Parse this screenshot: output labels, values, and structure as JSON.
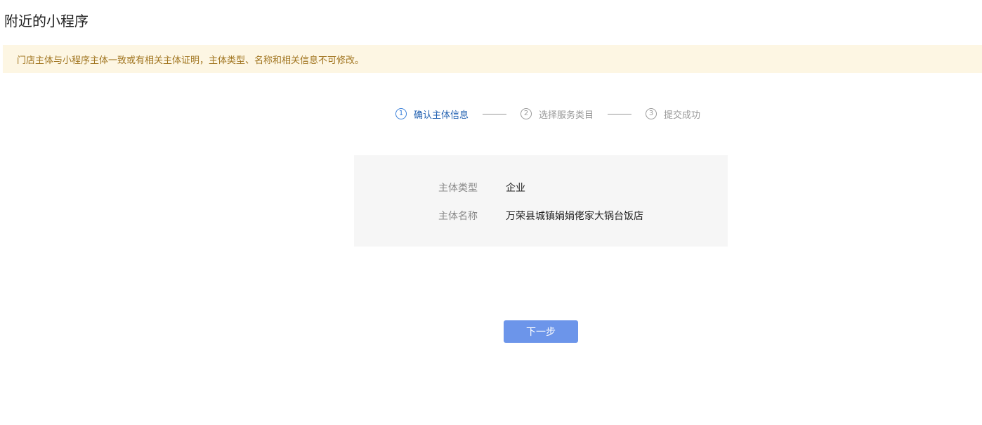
{
  "page": {
    "title": "附近的小程序"
  },
  "notice": {
    "text": "门店主体与小程序主体一致或有相关主体证明，主体类型、名称和相关信息不可修改。"
  },
  "steps": [
    {
      "number": "1",
      "label": "确认主体信息",
      "active": true
    },
    {
      "number": "2",
      "label": "选择服务类目",
      "active": false
    },
    {
      "number": "3",
      "label": "提交成功",
      "active": false
    }
  ],
  "info": {
    "type_label": "主体类型",
    "type_value": "企业",
    "name_label": "主体名称",
    "name_value": "万荣县城镇娟娟佬家大锅台饭店"
  },
  "actions": {
    "next_label": "下一步"
  },
  "colors": {
    "notice_bg": "#fdf6e3",
    "notice_text": "#a0741e",
    "active_step": "#1f5fb0",
    "primary_button": "#6c95ea"
  }
}
